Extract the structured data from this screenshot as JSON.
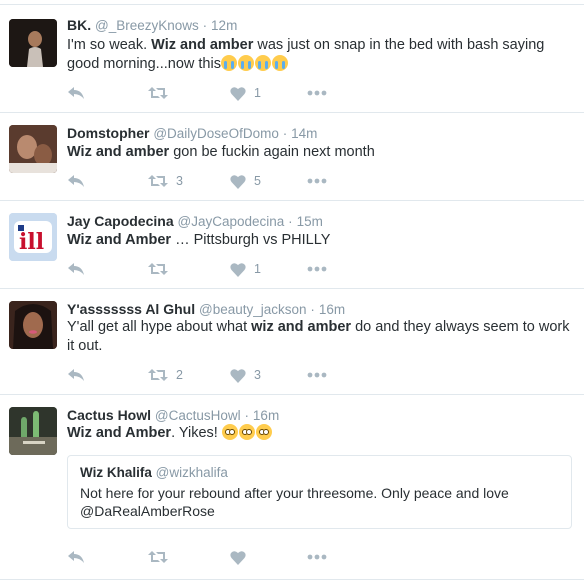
{
  "tweets": [
    {
      "name": "BK.",
      "handle": "@_BreezyKnows",
      "sep": "·",
      "time": "12m",
      "text_pre": "I'm so weak. ",
      "text_bold": "Wiz and amber",
      "text_post": " was just on snap in the bed with bash saying good morning...now this",
      "retweets": "",
      "likes": "1",
      "avatar_color": "#2b2320"
    },
    {
      "name": "Domstopher",
      "handle": "@DailyDoseOfDomo",
      "sep": "·",
      "time": "14m",
      "text_bold": "Wiz and amber",
      "text_post": " gon be fuckin again next month",
      "retweets": "3",
      "likes": "5",
      "avatar_color": "#6b4a3a"
    },
    {
      "name": "Jay Capodecina",
      "handle": "@JayCapodecina",
      "sep": "·",
      "time": "15m",
      "text_bold": "Wiz and Amber",
      "text_post": " … Pittsburgh vs PHILLY",
      "retweets": "",
      "likes": "1",
      "avatar_color": "#c9d9ec",
      "avatar_logo": "ill"
    },
    {
      "name": "Y'asssssss Al Ghul",
      "handle": "@beauty_jackson",
      "sep": "·",
      "time": "16m",
      "text_pre": "Y'all get all hype about what ",
      "text_bold": "wiz and amber",
      "text_post": " do and they always seem to work it out.",
      "retweets": "2",
      "likes": "3",
      "avatar_color": "#4a2e25"
    },
    {
      "name": "Cactus Howl",
      "handle": "@CactusHowl",
      "sep": "·",
      "time": "16m",
      "text_bold": "Wiz and Amber",
      "text_post": ". Yikes! ",
      "retweets": "",
      "likes": "",
      "avatar_color": "#3f4a3c",
      "quote": {
        "name": "Wiz Khalifa",
        "handle": "@wizkhalifa",
        "text": "Not here for your rebound after your threesome. Only peace and love @DaRealAmberRose"
      }
    }
  ],
  "icons": {
    "reply": "reply-icon",
    "retweet": "retweet-icon",
    "like": "heart-icon",
    "more": "more-icon"
  },
  "colors": {
    "text": "#292f33",
    "muted": "#8899a6",
    "icon": "#aab8c2",
    "border": "#e1e8ed"
  }
}
